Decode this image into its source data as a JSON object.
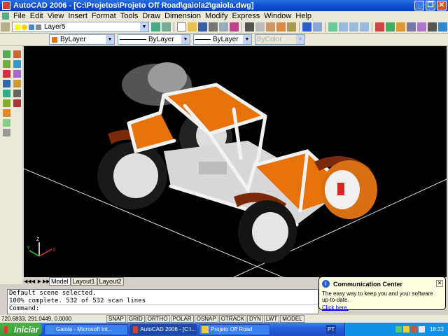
{
  "window": {
    "title": "AutoCAD 2006 - [C:\\Projetos\\Projeto Off Road\\gaiola2\\gaiola.dwg]"
  },
  "menu": [
    "File",
    "Edit",
    "View",
    "Insert",
    "Format",
    "Tools",
    "Draw",
    "Dimension",
    "Modify",
    "Express",
    "Window",
    "Help"
  ],
  "toolbar": {
    "layer_value": "Layer5",
    "color_value": "ByLayer",
    "linetype_value": "ByLayer",
    "lineweight_value": "ByLayer",
    "plotstyle_value": "ByColor"
  },
  "layout_tabs": [
    "Model",
    "Layout1",
    "Layout2"
  ],
  "command_lines": [
    "Default scene selected.",
    "100% complete. 532 of 532 scan lines",
    "Command:"
  ],
  "status": {
    "coords": "720.6833, 291.0449, 0.0000",
    "buttons": [
      "SNAP",
      "GRID",
      "ORTHO",
      "POLAR",
      "OSNAP",
      "OTRACK",
      "DYN",
      "LWT",
      "MODEL"
    ]
  },
  "balloon": {
    "title": "Communication Center",
    "text": "The easy way to keep you and your software up-to-date.",
    "link": "Click here."
  },
  "taskbar": {
    "start": "Iniciar",
    "tasks": [
      "Gaiola - Microsoft Int...",
      "AutoCAD 2006 - [C:\\...",
      "Projeto Off Road"
    ],
    "lang": "PT",
    "clock": "18:22"
  },
  "colors": {
    "vehicle_body": "#e8720a",
    "fender": "#7a2a0a",
    "viewport_bg": "#000000",
    "title_bar": "#0a4bd3"
  }
}
